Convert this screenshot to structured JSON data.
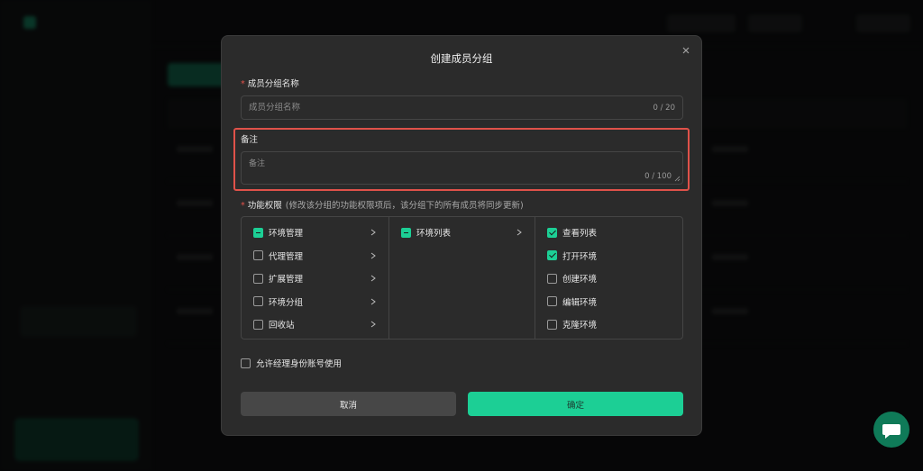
{
  "modal": {
    "title": "创建成员分组",
    "close_icon": "close-icon",
    "name_field": {
      "label": "成员分组名称",
      "placeholder": "成员分组名称",
      "counter": "0 / 20"
    },
    "remark_field": {
      "label": "备注",
      "placeholder": "备注",
      "counter": "0 / 100"
    },
    "permissions": {
      "label": "功能权限",
      "hint": "(修改该分组的功能权限项后，该分组下的所有成员将同步更新)",
      "col1": [
        {
          "label": "环境管理",
          "state": "partial"
        },
        {
          "label": "代理管理",
          "state": "unchecked"
        },
        {
          "label": "扩展管理",
          "state": "unchecked"
        },
        {
          "label": "环境分组",
          "state": "unchecked"
        },
        {
          "label": "回收站",
          "state": "unchecked"
        }
      ],
      "col2": [
        {
          "label": "环境列表",
          "state": "partial"
        }
      ],
      "col3": [
        {
          "label": "查看列表",
          "state": "checked"
        },
        {
          "label": "打开环境",
          "state": "checked"
        },
        {
          "label": "创建环境",
          "state": "unchecked"
        },
        {
          "label": "编辑环境",
          "state": "unchecked"
        },
        {
          "label": "克隆环境",
          "state": "unchecked"
        }
      ]
    },
    "allow_manager": "允许经理身份账号使用",
    "cancel_label": "取消",
    "ok_label": "确定"
  },
  "colors": {
    "accent": "#1ccf95",
    "highlight": "#e0524a",
    "modal_bg": "#2b2b2b"
  }
}
